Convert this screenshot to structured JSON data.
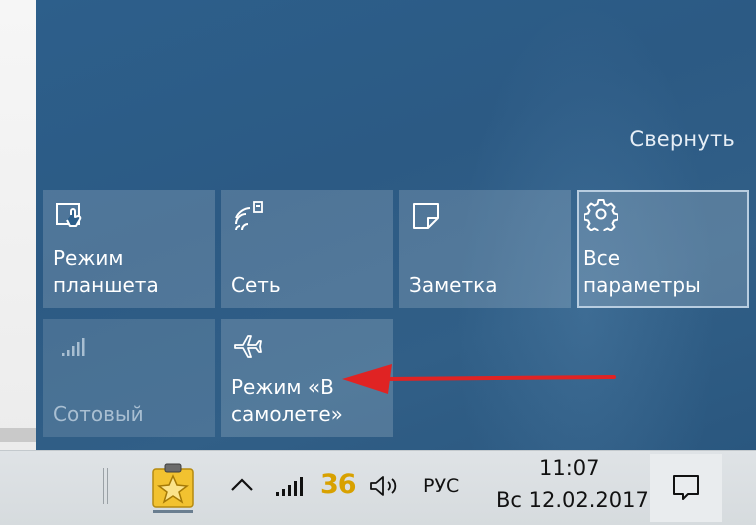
{
  "action_center": {
    "collapse_label": "Свернуть",
    "tiles": [
      {
        "label": "Режим\nпланшета",
        "icon": "tablet-mode-icon",
        "state": "normal"
      },
      {
        "label": "Сеть",
        "icon": "network-icon",
        "state": "normal"
      },
      {
        "label": "Заметка",
        "icon": "note-icon",
        "state": "normal"
      },
      {
        "label": "Все\nпараметры",
        "icon": "gear-icon",
        "state": "focused"
      },
      {
        "label": "Сотовый",
        "icon": "cellular-icon",
        "state": "disabled"
      },
      {
        "label": "Режим «В\nсамолете»",
        "icon": "airplane-icon",
        "state": "normal"
      }
    ],
    "annotation_arrow_color": "#e02323"
  },
  "taskbar": {
    "app_icon": "star-clipboard-icon",
    "temperature": "36",
    "language": "РУС",
    "time": "11:07",
    "date": "Вс 12.02.2017",
    "tray_icons": [
      "chevron-up-icon",
      "signal-icon",
      "volume-icon",
      "notification-icon"
    ]
  },
  "colors": {
    "panel": "#2d5f8b",
    "taskbar": "#dfe3e6",
    "temperature": "#d8a100"
  }
}
